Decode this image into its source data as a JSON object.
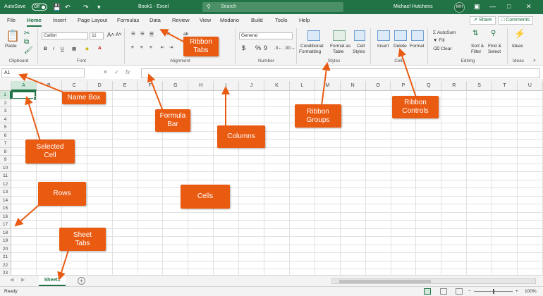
{
  "colors": {
    "accent": "#217346",
    "callout": "#ea5b12"
  },
  "titlebar": {
    "autosave_label": "AutoSave",
    "autosave_state": "Off",
    "doc_title": "Book1 - Excel",
    "search_placeholder": "Search",
    "user_name": "Michael Hutchens",
    "user_initials": "MH"
  },
  "tabs": [
    "File",
    "Home",
    "Insert",
    "Page Layout",
    "Formulas",
    "Data",
    "Review",
    "View",
    "Modano",
    "Build",
    "Tools",
    "Help"
  ],
  "active_tab": "Home",
  "share_label": "Share",
  "comments_label": "Comments",
  "ribbon": {
    "clipboard": {
      "label": "Clipboard",
      "paste": "Paste"
    },
    "font": {
      "label": "Font",
      "name": "Calibri",
      "size": "11"
    },
    "alignment": {
      "label": "Alignment",
      "wrap": "ab"
    },
    "number": {
      "label": "Number",
      "format": "General",
      "symbols": [
        "$",
        "%",
        "9"
      ]
    },
    "styles": {
      "label": "Styles",
      "conditional_1": "Conditional",
      "conditional_2": "Formatting",
      "format_as_1": "Format as",
      "format_as_2": "Table",
      "cell_styles_1": "Cell",
      "cell_styles_2": "Styles"
    },
    "cells": {
      "label": "Cells",
      "insert": "Insert",
      "delete": "Delete",
      "format": "Format"
    },
    "editing": {
      "label": "Editing",
      "autosum": "AutoSum",
      "fill": "Fill",
      "clear": "Clear",
      "sort_1": "Sort &",
      "sort_2": "Filter",
      "find_1": "Find &",
      "find_2": "Select"
    },
    "ideas": {
      "label": "Ideas",
      "button": "Ideas"
    }
  },
  "formula_bar": {
    "name_box": "A1",
    "value": ""
  },
  "columns": [
    "A",
    "B",
    "C",
    "D",
    "E",
    "F",
    "G",
    "H",
    "I",
    "J",
    "K",
    "L",
    "M",
    "N",
    "O",
    "P",
    "Q",
    "R",
    "S",
    "T",
    "U"
  ],
  "rows": [
    "1",
    "2",
    "3",
    "4",
    "5",
    "6",
    "7",
    "8",
    "9",
    "10",
    "11",
    "12",
    "13",
    "14",
    "15",
    "16",
    "17",
    "18",
    "19",
    "20",
    "21",
    "22",
    "23"
  ],
  "selected_cell": "A1",
  "sheet_tab": "Sheet1",
  "status": {
    "ready": "Ready",
    "zoom": "100%"
  },
  "callouts": [
    {
      "id": "ribbon-tabs",
      "line1": "Ribbon",
      "line2": "Tabs"
    },
    {
      "id": "name-box",
      "line1": "Name Box",
      "line2": ""
    },
    {
      "id": "formula-bar",
      "line1": "Formula",
      "line2": "Bar"
    },
    {
      "id": "columns",
      "line1": "Columns",
      "line2": ""
    },
    {
      "id": "ribbon-groups",
      "line1": "Ribbon",
      "line2": "Groups"
    },
    {
      "id": "ribbon-controls",
      "line1": "Ribbon",
      "line2": "Controls"
    },
    {
      "id": "selected-cell",
      "line1": "Selected",
      "line2": "Cell"
    },
    {
      "id": "rows",
      "line1": "Rows",
      "line2": ""
    },
    {
      "id": "cells",
      "line1": "Cells",
      "line2": ""
    },
    {
      "id": "sheet-tabs",
      "line1": "Sheet",
      "line2": "Tabs"
    }
  ]
}
